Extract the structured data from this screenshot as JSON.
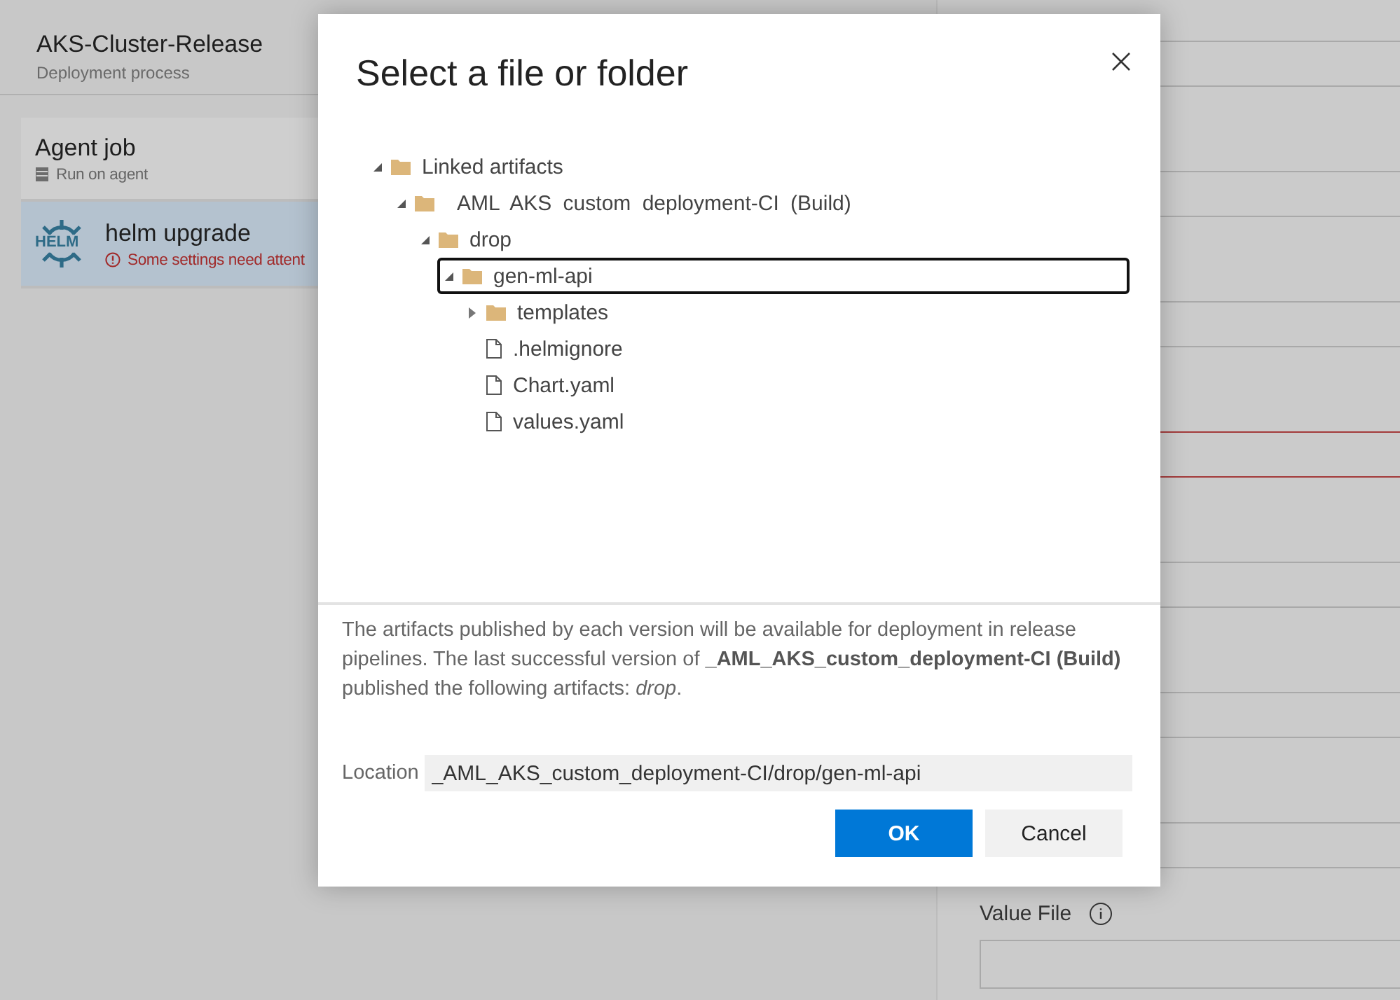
{
  "pipeline": {
    "title": "AKS-Cluster-Release",
    "subtitle": "Deployment process"
  },
  "jobs": [
    {
      "kind": "agent",
      "title": "Agent job",
      "detail": "Run on agent",
      "selected": false
    },
    {
      "kind": "task",
      "title": "helm upgrade",
      "detail": "Some settings need attent",
      "logo_text": "HELM",
      "selected": true
    }
  ],
  "right_panel": {
    "fields": [
      {
        "invalid": false
      },
      {
        "invalid": false
      },
      {
        "invalid": false
      },
      {
        "invalid": true
      },
      {
        "invalid": false
      },
      {
        "invalid": false
      },
      {
        "invalid": false
      }
    ],
    "value_file": {
      "label": "Value File"
    }
  },
  "dialog": {
    "title": "Select a file or folder",
    "tree": [
      {
        "label": "Linked artifacts",
        "kind": "folder",
        "expanded": true,
        "selected": false,
        "children": [
          {
            "label": "AML AKS custom deployment-CI (Build)",
            "kind": "folder",
            "expanded": true,
            "selected": false,
            "children": [
              {
                "label": "drop",
                "kind": "folder",
                "expanded": true,
                "selected": false,
                "children": [
                  {
                    "label": "gen-ml-api",
                    "kind": "folder",
                    "expanded": true,
                    "selected": true,
                    "children": [
                      {
                        "label": "templates",
                        "kind": "folder",
                        "expanded": false,
                        "selected": false
                      },
                      {
                        "label": ".helmignore",
                        "kind": "file",
                        "selected": false
                      },
                      {
                        "label": "Chart.yaml",
                        "kind": "file",
                        "selected": false
                      },
                      {
                        "label": "values.yaml",
                        "kind": "file",
                        "selected": false
                      }
                    ]
                  }
                ]
              }
            ]
          }
        ]
      }
    ],
    "note": "The artifacts published by each version will be available for deployment in release pipelines. The last successful version of **_AML_AKS_custom_deployment-CI (Build)** published the following artifacts: *drop*.",
    "location": {
      "label": "Location",
      "value": "_AML_AKS_custom_deployment-CI/drop/gen-ml-api"
    },
    "buttons": [
      {
        "label": "OK",
        "kind": "primary"
      },
      {
        "label": "Cancel",
        "kind": "secondary"
      }
    ]
  }
}
